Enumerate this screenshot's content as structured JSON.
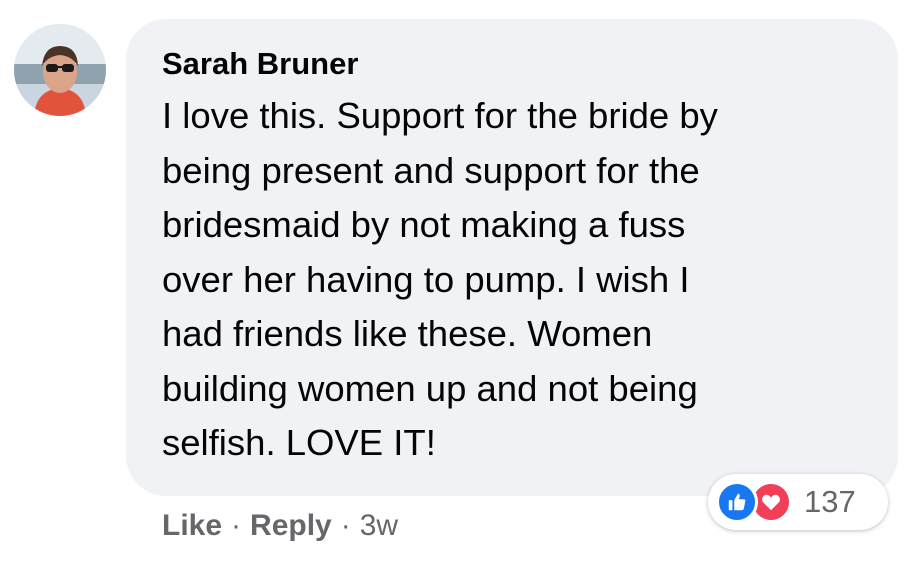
{
  "comment": {
    "author": "Sarah Bruner",
    "lines": [
      "I love this. Support for the bride by",
      "being present and support for the",
      "bridesmaid by not making a fuss",
      "over her having to pump. I wish I",
      "had friends like these. Women",
      "building women up and not being",
      "selfish. LOVE IT!"
    ]
  },
  "actions": {
    "like_label": "Like",
    "reply_label": "Reply",
    "separator": "·",
    "timestamp": "3w"
  },
  "reactions": {
    "icons": [
      "thumbs-up-icon",
      "heart-icon"
    ],
    "count": "137",
    "like_color": "#1877f2",
    "love_color": "#f33e58"
  },
  "colors": {
    "bubble_bg": "#f0f2f5",
    "text": "#050505",
    "secondary_text": "#65676b"
  }
}
